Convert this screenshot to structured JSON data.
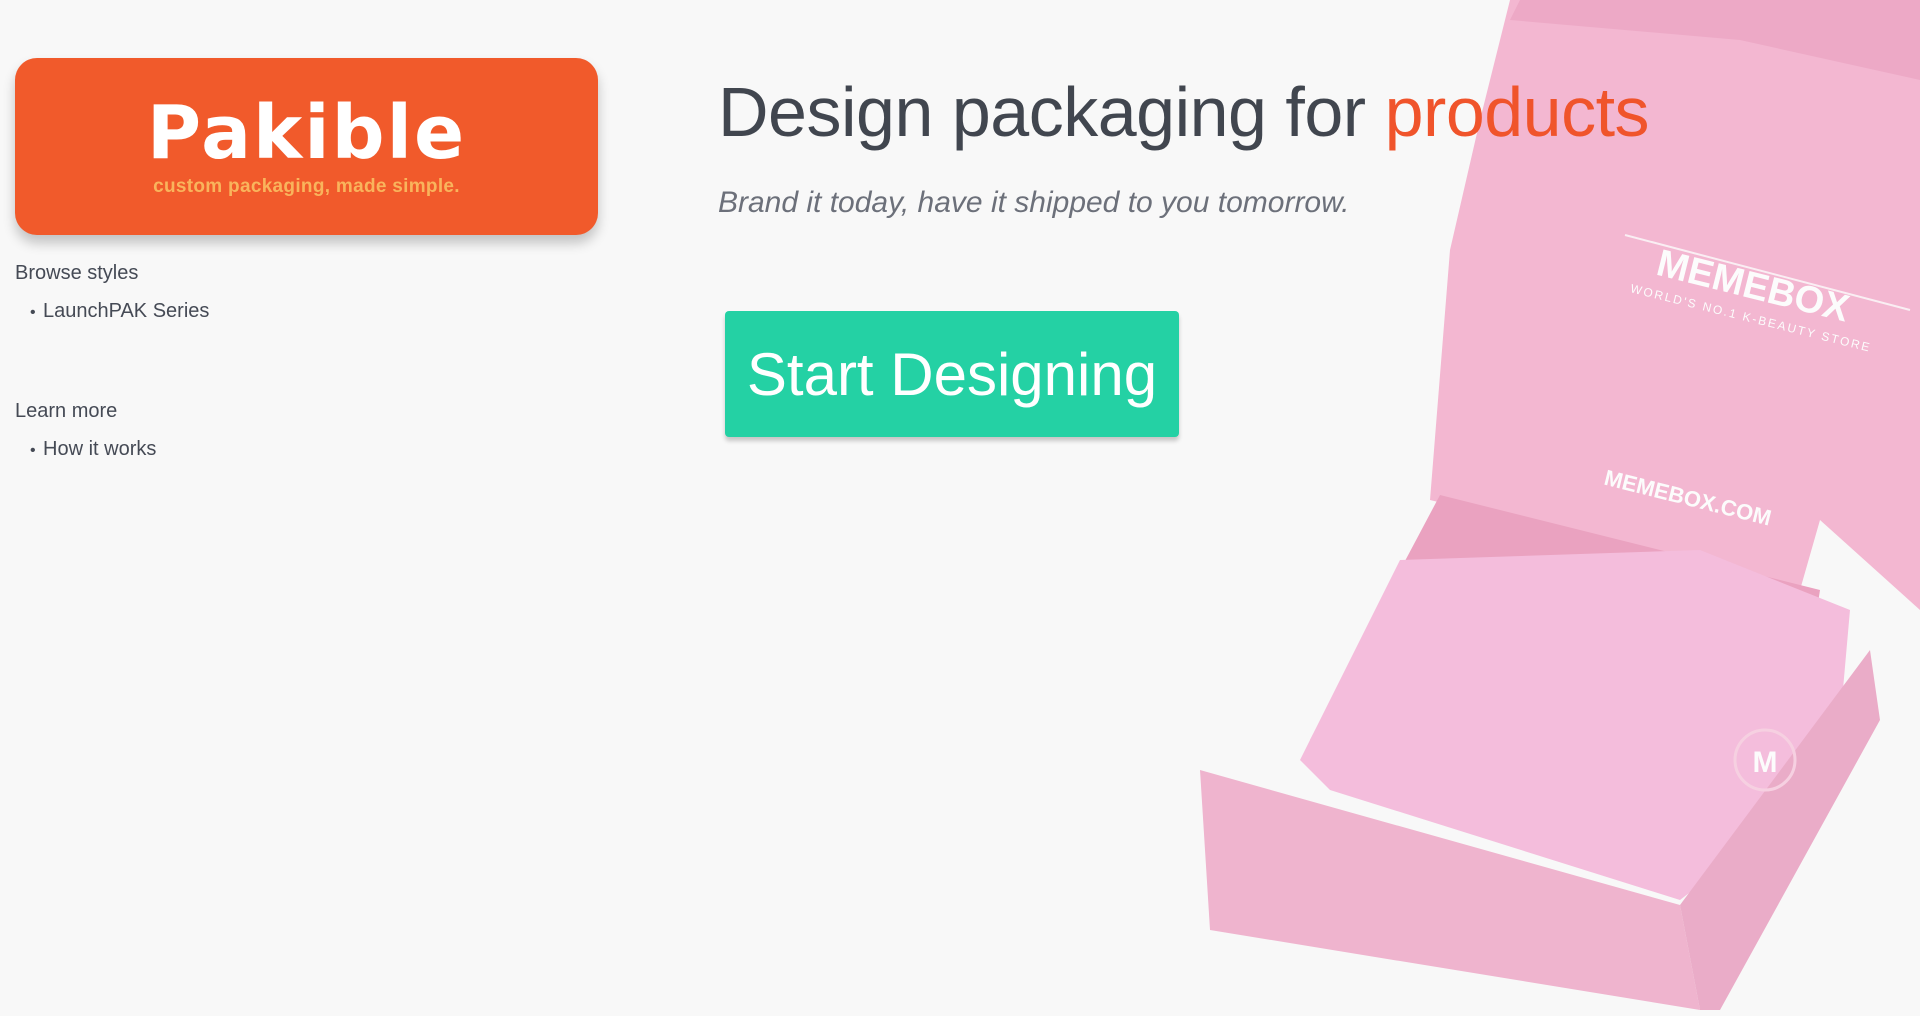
{
  "logo": {
    "name": "Pakible",
    "tagline": "custom packaging, made simple."
  },
  "nav": {
    "browse": {
      "heading": "Browse styles",
      "items": [
        "LaunchPAK Series"
      ]
    },
    "learn": {
      "heading": "Learn more",
      "items": [
        "How it works"
      ]
    },
    "bullet": "•"
  },
  "hero": {
    "title_prefix": "Design packaging for ",
    "title_accent": "products",
    "subtitle": "Brand it today, have it shipped to you tomorrow.",
    "cta_label": "Start Designing"
  },
  "product_image": {
    "brand": "MEMEBOX",
    "brand_tagline": "WORLD'S NO.1 K-BEAUTY STORE",
    "url_text": "MEMEBOX.COM",
    "seal_letter": "M"
  },
  "colors": {
    "brand_orange": "#f15a2b",
    "tagline_orange": "#f9b45c",
    "accent_text": "#f0542b",
    "cta_green": "#24d1a4",
    "background": "#f8f8f8",
    "box_pink": "#ee8fb6"
  }
}
